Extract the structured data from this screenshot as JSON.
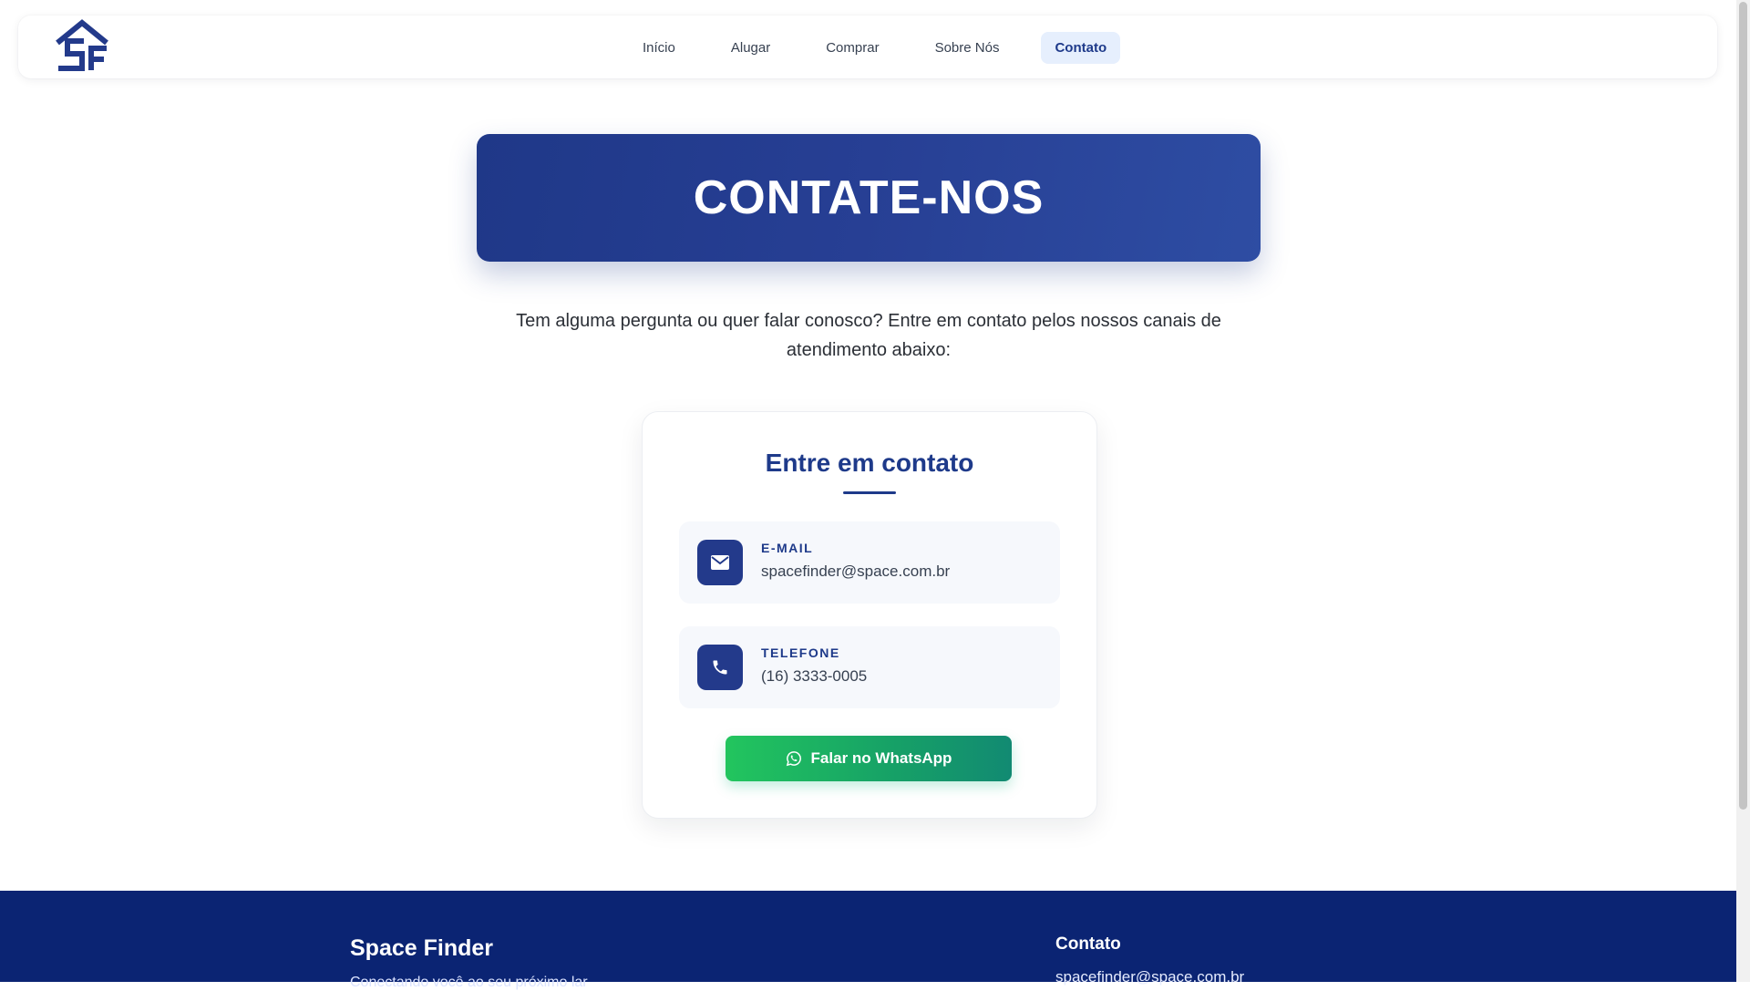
{
  "navbar": {
    "logo_icon": "space-finder-house-logo",
    "links": [
      {
        "label": "Início",
        "active": false
      },
      {
        "label": "Alugar",
        "active": false
      },
      {
        "label": "Comprar",
        "active": false
      },
      {
        "label": "Sobre Nós",
        "active": false
      },
      {
        "label": "Contato",
        "active": true
      }
    ]
  },
  "hero": {
    "title": "CONTATE-NOS"
  },
  "intro": {
    "text": "Tem alguma pergunta ou quer falar conosco? Entre em contato pelos nossos canais de atendimento abaixo:"
  },
  "contact_card": {
    "title": "Entre em contato",
    "email": {
      "icon": "envelope-icon",
      "label": "E-MAIL",
      "value": "spacefinder@space.com.br"
    },
    "phone": {
      "icon": "phone-icon",
      "label": "TELEFONE",
      "value": "(16) 3333-0005"
    },
    "whatsapp_button": {
      "icon": "whatsapp-icon",
      "label": "Falar no WhatsApp"
    }
  },
  "footer": {
    "brand": "Space Finder",
    "tagline": "Conectando você ao seu próximo lar",
    "contact_heading": "Contato",
    "contact_email": "spacefinder@space.com.br"
  },
  "colors": {
    "primary": "#1e3a8a",
    "footer_bg": "#0b2473",
    "whatsapp_green": "#22c55e",
    "active_nav_bg": "#e6effd"
  }
}
